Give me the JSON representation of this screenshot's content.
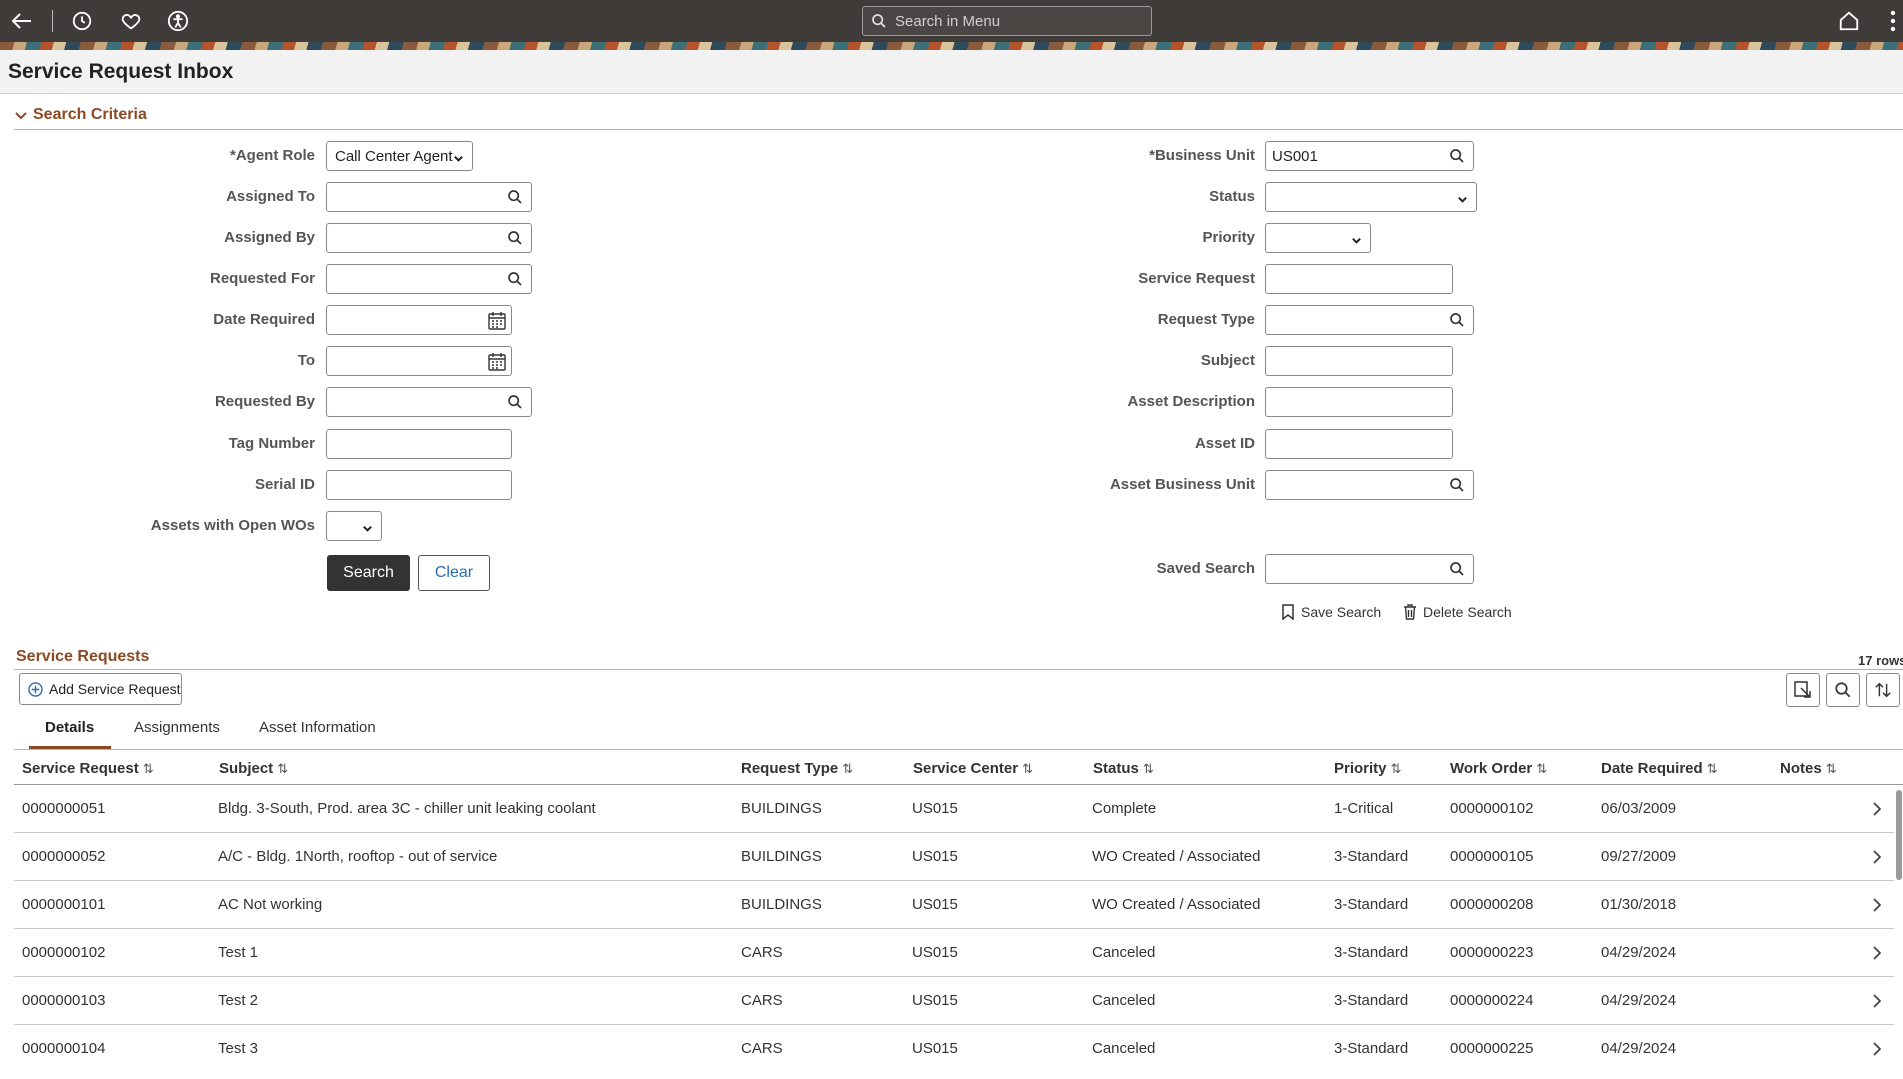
{
  "topbar": {
    "search_placeholder": "Search in Menu"
  },
  "page": {
    "title": "Service Request Inbox"
  },
  "criteria": {
    "title": "Search Criteria",
    "left": {
      "agent_role": {
        "label": "Agent Role",
        "value": "Call Center Agent"
      },
      "assigned_to": {
        "label": "Assigned To",
        "value": ""
      },
      "assigned_by": {
        "label": "Assigned By",
        "value": ""
      },
      "requested_for": {
        "label": "Requested For",
        "value": ""
      },
      "date_required": {
        "label": "Date Required",
        "value": ""
      },
      "to": {
        "label": "To",
        "value": ""
      },
      "requested_by": {
        "label": "Requested By",
        "value": ""
      },
      "tag_number": {
        "label": "Tag Number",
        "value": ""
      },
      "serial_id": {
        "label": "Serial ID",
        "value": ""
      },
      "assets_open_wos": {
        "label": "Assets with Open WOs",
        "value": ""
      }
    },
    "right": {
      "business_unit": {
        "label": "Business Unit",
        "value": "US001"
      },
      "status": {
        "label": "Status",
        "value": ""
      },
      "priority": {
        "label": "Priority",
        "value": ""
      },
      "service_request": {
        "label": "Service Request",
        "value": ""
      },
      "request_type": {
        "label": "Request Type",
        "value": ""
      },
      "subject": {
        "label": "Subject",
        "value": ""
      },
      "asset_description": {
        "label": "Asset Description",
        "value": ""
      },
      "asset_id": {
        "label": "Asset ID",
        "value": ""
      },
      "asset_business_unit": {
        "label": "Asset Business Unit",
        "value": ""
      },
      "saved_search": {
        "label": "Saved Search",
        "value": ""
      }
    },
    "required_mark": "*",
    "search_button": "Search",
    "clear_button": "Clear",
    "save_search": "Save Search",
    "delete_search": "Delete Search"
  },
  "grid": {
    "title": "Service Requests",
    "row_count": "17 rows",
    "add_button": "Add Service Request",
    "tabs": [
      "Details",
      "Assignments",
      "Asset Information"
    ],
    "columns": [
      "Service Request",
      "Subject",
      "Request Type",
      "Service Center",
      "Status",
      "Priority",
      "Work Order",
      "Date Required",
      "Notes"
    ],
    "sort_glyph": "⇅",
    "rows": [
      [
        "0000000051",
        "Bldg. 3-South, Prod. area 3C - chiller unit leaking coolant",
        "BUILDINGS",
        "US015",
        "Complete",
        "1-Critical",
        "0000000102",
        "06/03/2009"
      ],
      [
        "0000000052",
        "A/C - Bldg. 1North, rooftop - out of service",
        "BUILDINGS",
        "US015",
        "WO Created / Associated",
        "3-Standard",
        "0000000105",
        "09/27/2009"
      ],
      [
        "0000000101",
        "AC Not working",
        "BUILDINGS",
        "US015",
        "WO Created / Associated",
        "3-Standard",
        "0000000208",
        "01/30/2018"
      ],
      [
        "0000000102",
        "Test 1",
        "CARS",
        "US015",
        "Canceled",
        "3-Standard",
        "0000000223",
        "04/29/2024"
      ],
      [
        "0000000103",
        "Test 2",
        "CARS",
        "US015",
        "Canceled",
        "3-Standard",
        "0000000224",
        "04/29/2024"
      ],
      [
        "0000000104",
        "Test 3",
        "CARS",
        "US015",
        "Canceled",
        "3-Standard",
        "0000000225",
        "04/29/2024"
      ]
    ]
  }
}
